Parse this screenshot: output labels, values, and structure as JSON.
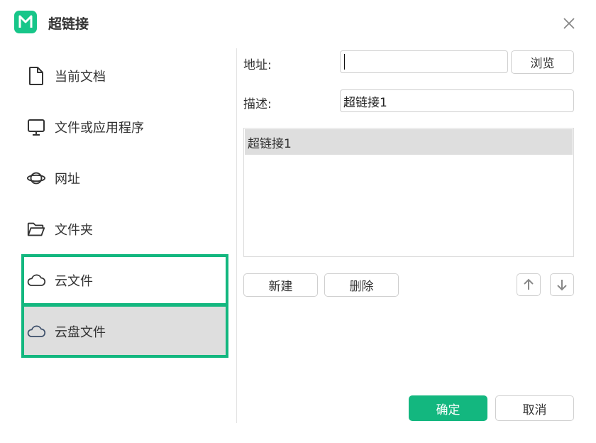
{
  "dialog": {
    "title": "超链接"
  },
  "nav": {
    "items": [
      {
        "label": "当前文档",
        "icon": "document-icon"
      },
      {
        "label": "文件或应用程序",
        "icon": "monitor-icon"
      },
      {
        "label": "网址",
        "icon": "planet-icon"
      },
      {
        "label": "文件夹",
        "icon": "folder-icon"
      },
      {
        "label": "云文件",
        "icon": "cloud-icon"
      },
      {
        "label": "云盘文件",
        "icon": "cloud-icon"
      }
    ],
    "selected_index": 5
  },
  "form": {
    "address_label": "地址:",
    "address_value": "",
    "browse_label": "浏览",
    "description_label": "描述:",
    "description_value": "超链接1"
  },
  "list": {
    "items": [
      "超链接1"
    ]
  },
  "actions": {
    "new_label": "新建",
    "delete_label": "删除",
    "ok_label": "确定",
    "cancel_label": "取消"
  },
  "colors": {
    "accent": "#13b77f",
    "selected_bg": "#dedede"
  }
}
